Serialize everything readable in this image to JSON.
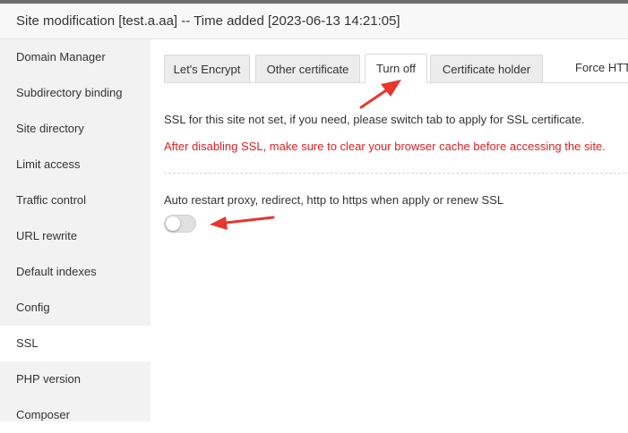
{
  "header": {
    "title": "Site modification [test.a.aa] -- Time added [2023-06-13 14:21:05]"
  },
  "sidebar": {
    "items": [
      {
        "label": "Domain Manager"
      },
      {
        "label": "Subdirectory binding"
      },
      {
        "label": "Site directory"
      },
      {
        "label": "Limit access"
      },
      {
        "label": "Traffic control"
      },
      {
        "label": "URL rewrite"
      },
      {
        "label": "Default indexes"
      },
      {
        "label": "Config"
      },
      {
        "label": "SSL",
        "active": true
      },
      {
        "label": "PHP version"
      },
      {
        "label": "Composer"
      }
    ]
  },
  "ssl": {
    "tabs": [
      {
        "label": "Let's Encrypt"
      },
      {
        "label": "Other certificate"
      },
      {
        "label": "Turn off",
        "active": true
      },
      {
        "label": "Certificate holder"
      },
      {
        "label": "Force HTT"
      }
    ],
    "info_text": "SSL for this site not set, if you need, please switch tab to apply for SSL certificate.",
    "warning_text": "After disabling SSL, make sure to clear your browser cache before accessing the site.",
    "toggle": {
      "label": "Auto restart proxy, redirect, http to https when apply or renew SSL",
      "on": false
    }
  },
  "colors": {
    "accent_warning": "#e02020",
    "annotation_arrow": "#e8352e",
    "sidebar_bg": "#f2f2f2"
  },
  "icons": {
    "annotation": "red-arrow-icon"
  }
}
